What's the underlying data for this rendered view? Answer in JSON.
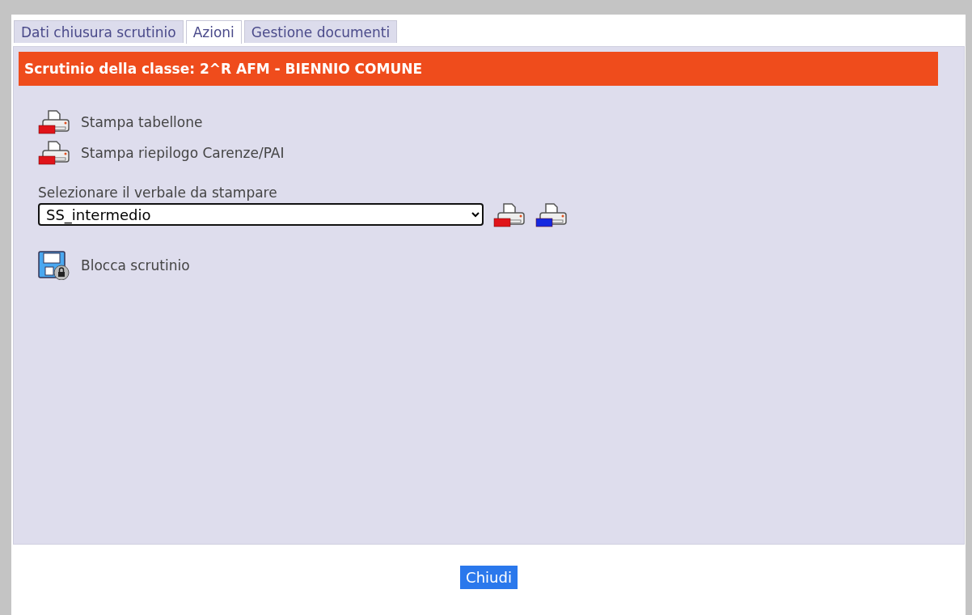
{
  "tabs": [
    {
      "label": "Dati chiusura scrutinio",
      "selected": false
    },
    {
      "label": "Azioni",
      "selected": true
    },
    {
      "label": "Gestione documenti",
      "selected": false
    }
  ],
  "header": "Scrutinio della classe: 2^R AFM - BIENNIO COMUNE",
  "actions": [
    {
      "label": "Stampa tabellone",
      "kind": "pdf"
    },
    {
      "label": "Stampa riepilogo Carenze/PAI",
      "kind": "pdf"
    }
  ],
  "verbale": {
    "label": "Selezionare il verbale da stampare",
    "value": "SS_intermedio",
    "exports": [
      {
        "kind": "pdf"
      },
      {
        "kind": "word"
      }
    ]
  },
  "lock_action": {
    "label": "Blocca scrutinio",
    "kind": "lock"
  },
  "close_button": "Chiudi"
}
